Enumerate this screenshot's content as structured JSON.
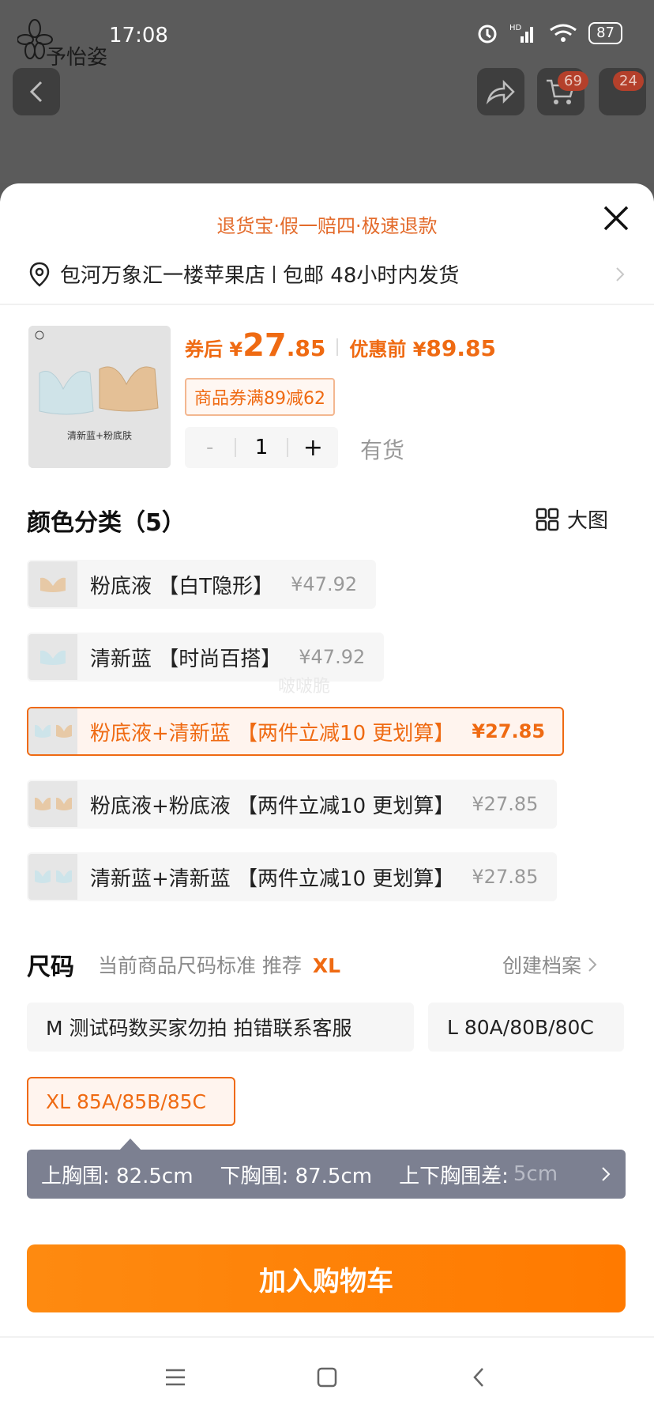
{
  "status": {
    "time": "17:08",
    "battery": "87",
    "network": "HD"
  },
  "brand": {
    "name": "予怡姿"
  },
  "header": {
    "cart_count": "69",
    "msg_count": "24"
  },
  "sheet": {
    "banner": "退货宝·假一赔四·极速退款",
    "address": "包河万象汇一楼苹果店",
    "shipping": "包邮 48小时内发货"
  },
  "product": {
    "thumb_caption": "清新蓝+粉底肤",
    "after_coupon_label": "券后 ¥",
    "after_coupon_int": "27",
    "after_coupon_dec": ".85",
    "before_label": "优惠前 ¥",
    "before_price": "89.85",
    "coupon_text": "商品券满89减62",
    "qty_minus": "-",
    "qty": "1",
    "qty_plus": "+",
    "stock": "有货"
  },
  "color": {
    "title": "颜色分类（5）",
    "big_image_label": "大图",
    "options": [
      {
        "name": "粉底液 【白T隐形】",
        "price": "¥47.92",
        "swatch": "#e7c9a6"
      },
      {
        "name": "清新蓝 【时尚百搭】",
        "price": "¥47.92",
        "swatch": "#cde4ea"
      },
      {
        "name": "粉底液+清新蓝 【两件立减10 更划算】",
        "price": "¥27.85",
        "swatch": "#cde4ea"
      },
      {
        "name": "粉底液+粉底液 【两件立减10 更划算】",
        "price": "¥27.85",
        "swatch": "#e7c9a6"
      },
      {
        "name": "清新蓝+清新蓝 【两件立减10 更划算】",
        "price": "¥27.85",
        "swatch": "#cde4ea"
      }
    ],
    "watermark": "啵啵脆"
  },
  "size": {
    "title": "尺码",
    "hint": "当前商品尺码标准 推荐",
    "recommend": "XL",
    "profile_link": "创建档案",
    "options": [
      {
        "label": "M 测试码数买家勿拍 拍错联系客服"
      },
      {
        "label": "L 80A/80B/80C"
      },
      {
        "label": "XL 85A/85B/85C"
      }
    ],
    "measure": {
      "upper": "上胸围: 82.5cm",
      "lower": "下胸围: 87.5cm",
      "diff_label": "上下胸围差:",
      "diff_value": "5cm"
    }
  },
  "cart_button": "加入购物车",
  "colors": {
    "accent": "#ef6a12",
    "button": "#ff8000",
    "selected_bg": "#fff4ee"
  }
}
